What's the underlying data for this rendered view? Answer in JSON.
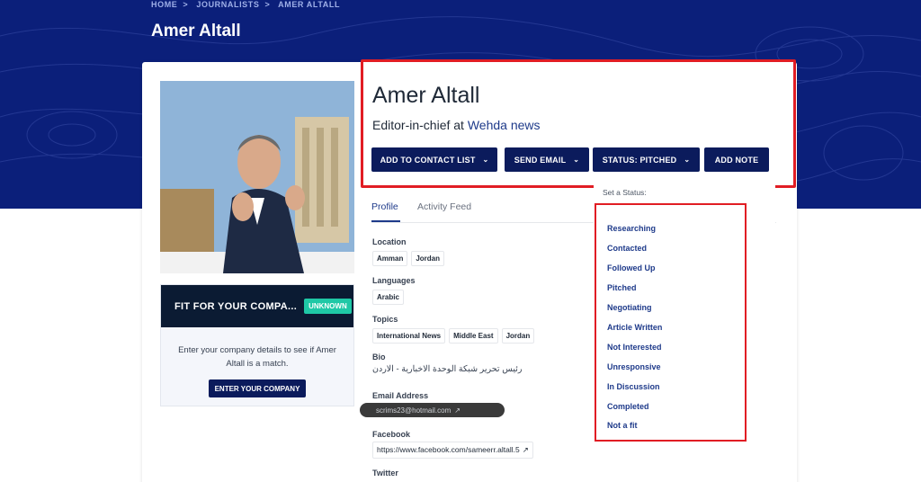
{
  "breadcrumb": [
    "HOME",
    "JOURNALISTS",
    "AMER ALTALL"
  ],
  "breadcrumb_separator": ">",
  "page_title": "Amer Altall",
  "profile": {
    "name": "Amer Altall",
    "title_prefix": "Editor-in-chief at ",
    "company": "Wehda news"
  },
  "actions": {
    "add_to_contact_list": "ADD TO CONTACT LIST",
    "send_email": "SEND EMAIL",
    "status": "STATUS: PITCHED",
    "add_note": "ADD NOTE"
  },
  "tabs": [
    "Profile",
    "Activity Feed"
  ],
  "details": {
    "location_label": "Location",
    "location": [
      "Amman",
      "Jordan"
    ],
    "languages_label": "Languages",
    "languages": [
      "Arabic"
    ],
    "topics_label": "Topics",
    "topics": [
      "International News",
      "Middle East",
      "Jordan"
    ],
    "bio_label": "Bio",
    "bio": "رئيس تحرير شبكة الوحدة الاخبارية - الاردن",
    "email_label": "Email Address",
    "email": "scrims23@hotmail.com",
    "facebook_label": "Facebook",
    "facebook": "https://www.facebook.com/sameerr.altall.5",
    "twitter_label": "Twitter"
  },
  "fit": {
    "title": "FIT FOR YOUR COMPA...",
    "badge": "UNKNOWN",
    "text": "Enter your company details to see if Amer Altall is a match.",
    "button": "ENTER YOUR COMPANY"
  },
  "status_menu": {
    "title": "Set a Status:",
    "items": [
      "Researching",
      "Contacted",
      "Followed Up",
      "Pitched",
      "Negotiating",
      "Article Written",
      "Not Interested",
      "Unresponsive",
      "In Discussion",
      "Completed",
      "Not a fit"
    ]
  },
  "colors": {
    "hero_bg": "#0b1f7a",
    "button_bg": "#0b1b5c",
    "highlight": "#e11d24",
    "badge": "#1fc8a6"
  }
}
